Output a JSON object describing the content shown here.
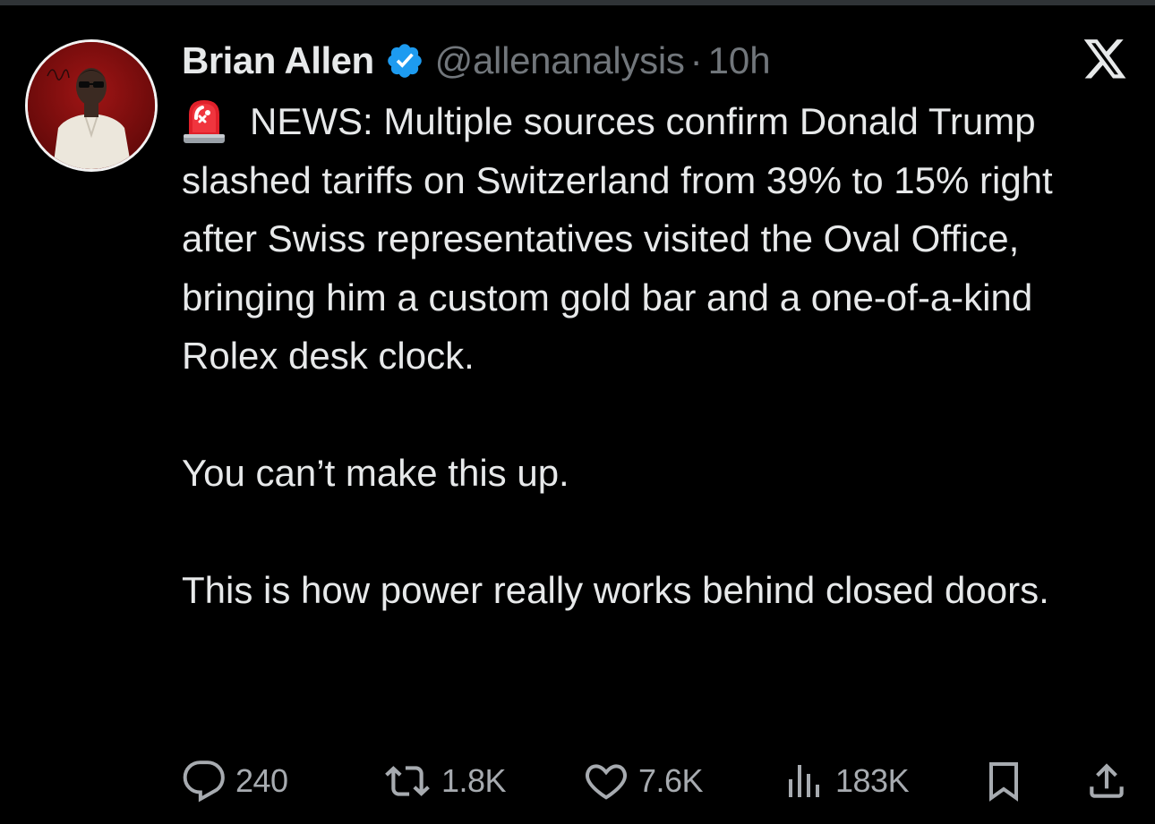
{
  "author": {
    "name": "Brian Allen",
    "handle": "@allenanalysis",
    "separator": "·",
    "time": "10h",
    "verified": true
  },
  "icons": {
    "verified": "verified-badge-icon",
    "platform": "x-logo-icon",
    "siren": "rotating-light-emoji"
  },
  "tweet": {
    "line1": "NEWS: Multiple sources confirm Donald Trump slashed tariffs on Switzerland from 39% to 15% right after Swiss representatives visited the Oval Office, bringing him a custom gold bar and a one-of-a-kind Rolex desk clock.",
    "line2": "You can’t make this up.",
    "line3": "This is how power really works behind closed doors."
  },
  "actions": {
    "replies": "240",
    "reposts": "1.8K",
    "likes": "7.6K",
    "views": "183K"
  },
  "colors": {
    "background": "#000000",
    "text": "#e7e9ea",
    "muted": "#71767b",
    "verified": "#1d9bf0"
  }
}
